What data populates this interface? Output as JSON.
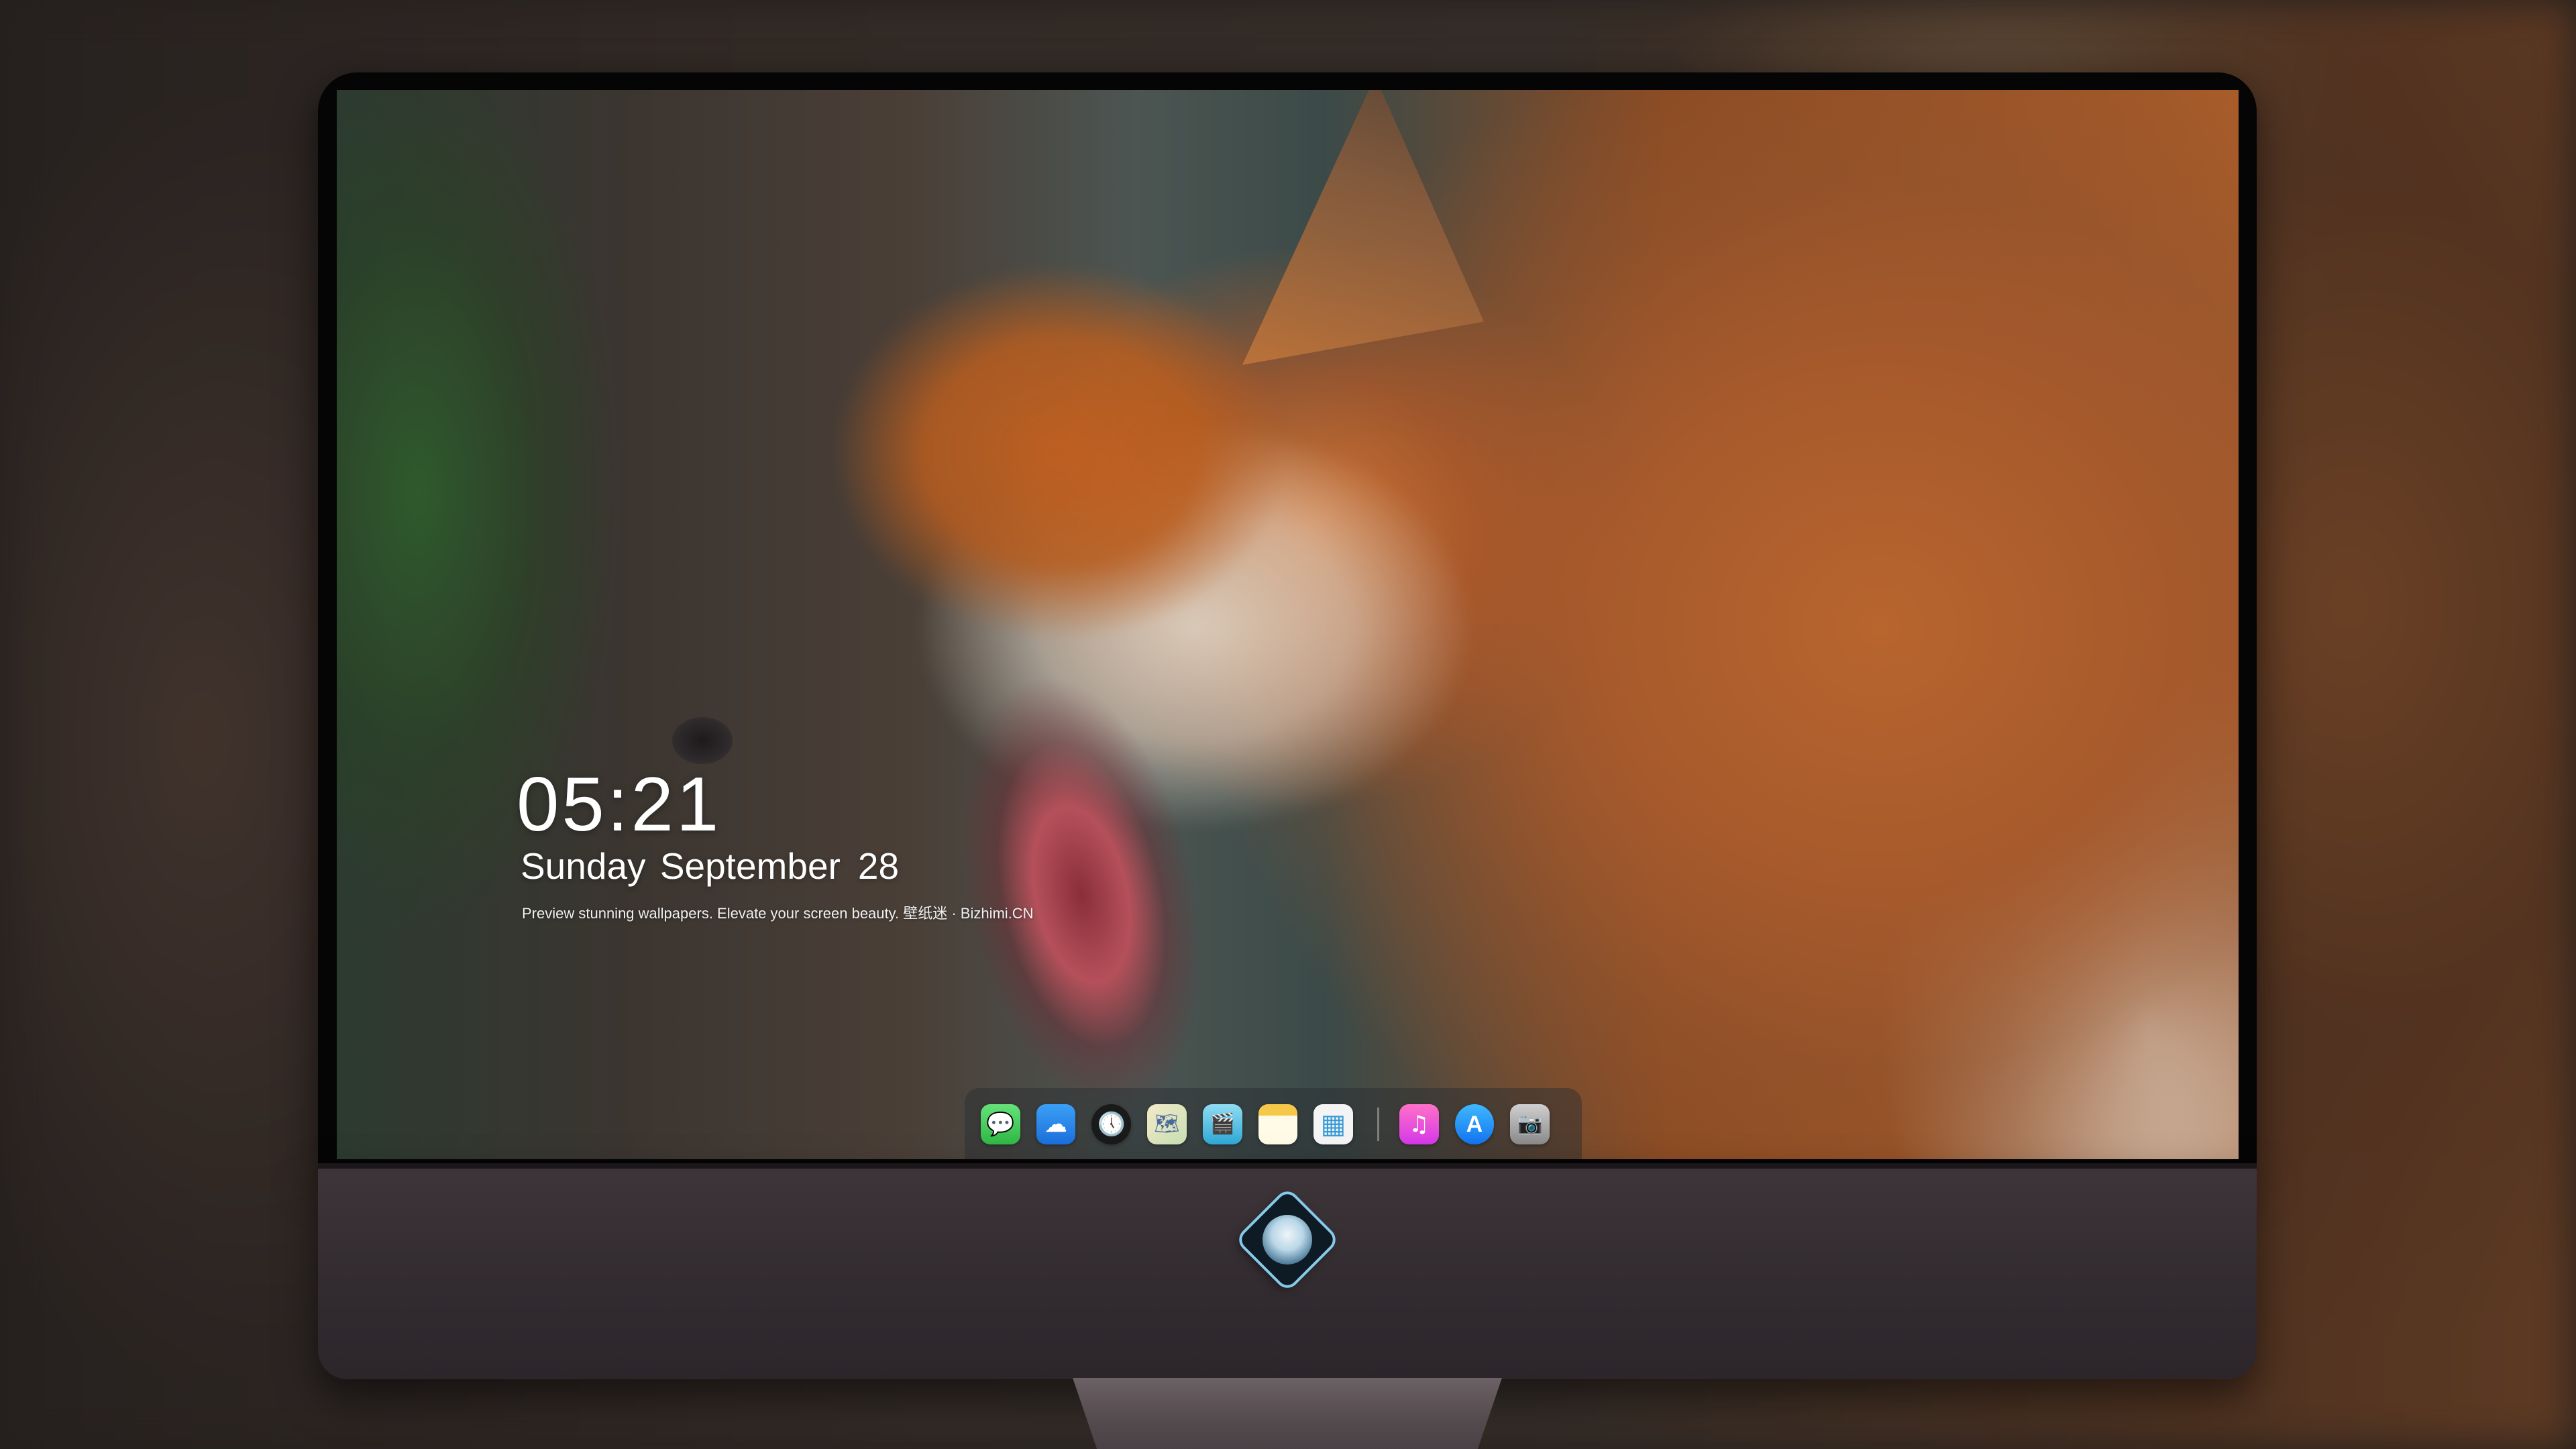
{
  "lockscreen": {
    "time": "05:21",
    "weekday_month": "Sunday September",
    "day": "28",
    "tagline": "Preview stunning wallpapers. Elevate your screen beauty. 壁纸迷 · Bizhimi.CN"
  },
  "dock": {
    "items": [
      {
        "icon": "messages-icon",
        "glyph": "💬"
      },
      {
        "icon": "weather-icon",
        "glyph": "☁"
      },
      {
        "icon": "clock-icon",
        "glyph": "🕔"
      },
      {
        "icon": "maps-icon",
        "glyph": "🗺"
      },
      {
        "icon": "clips-icon",
        "glyph": "🎬"
      },
      {
        "icon": "notes-icon",
        "glyph": ""
      },
      {
        "icon": "photos-icon",
        "glyph": "▦"
      },
      {
        "icon": "music-icon",
        "glyph": "♫"
      },
      {
        "icon": "app-store-icon",
        "glyph": "A"
      },
      {
        "icon": "camera-icon",
        "glyph": "📷"
      }
    ]
  },
  "colors": {
    "accent_music": "#ff71c7",
    "accent_appstore": "#1274f0",
    "chin": "#3d3539",
    "bezel": "#050505"
  }
}
